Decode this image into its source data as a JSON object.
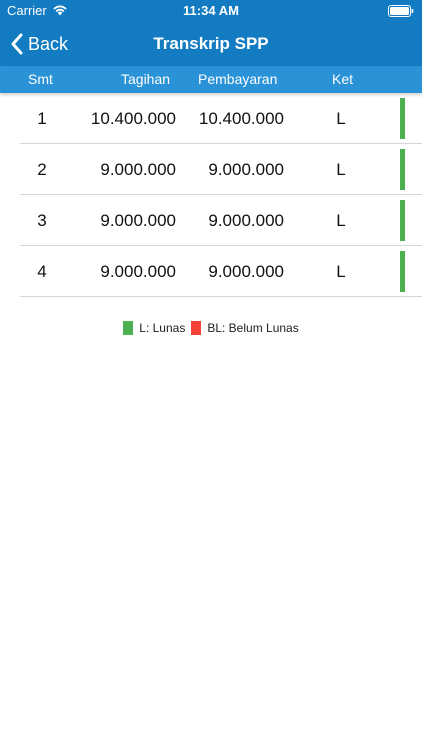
{
  "status_bar": {
    "carrier": "Carrier",
    "time": "11:34 AM"
  },
  "nav": {
    "back_label": "Back",
    "title": "Transkrip SPP"
  },
  "table": {
    "headers": {
      "smt": "Smt",
      "tagihan": "Tagihan",
      "pembayaran": "Pembayaran",
      "ket": "Ket"
    },
    "rows": [
      {
        "smt": "1",
        "tagihan": "10.400.000",
        "pembayaran": "10.400.000",
        "ket": "L",
        "status_color": "#4caf50"
      },
      {
        "smt": "2",
        "tagihan": "9.000.000",
        "pembayaran": "9.000.000",
        "ket": "L",
        "status_color": "#4caf50"
      },
      {
        "smt": "3",
        "tagihan": "9.000.000",
        "pembayaran": "9.000.000",
        "ket": "L",
        "status_color": "#4caf50"
      },
      {
        "smt": "4",
        "tagihan": "9.000.000",
        "pembayaran": "9.000.000",
        "ket": "L",
        "status_color": "#4caf50"
      }
    ]
  },
  "legend": {
    "lunas": {
      "label": "L: Lunas",
      "color": "#4caf50"
    },
    "belum_lunas": {
      "label": "BL: Belum Lunas",
      "color": "#f44336"
    }
  },
  "colors": {
    "nav_bg": "#127bc1",
    "header_bg": "#2a92d6"
  }
}
